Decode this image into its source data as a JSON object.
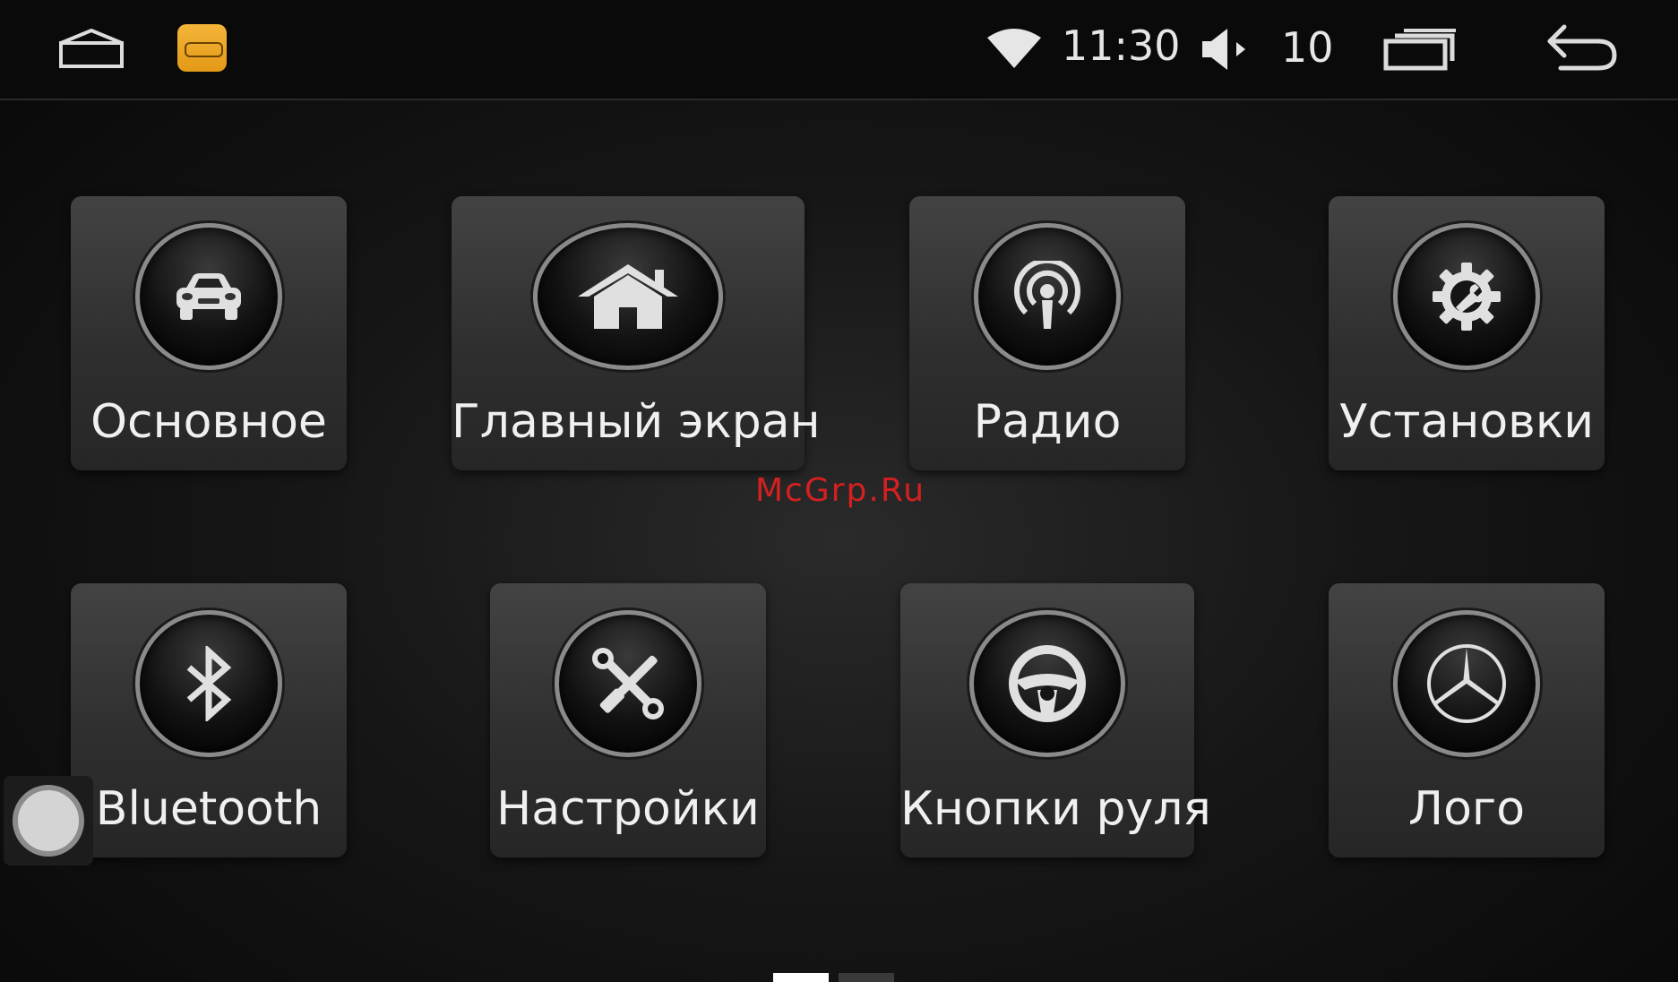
{
  "status_bar": {
    "time": "11:30",
    "volume_level": "10",
    "app_badge_color": "#f0a82a"
  },
  "tiles": [
    {
      "label": "Основное",
      "icon": "car-icon"
    },
    {
      "label": "Главный экран",
      "icon": "house-icon"
    },
    {
      "label": "Радио",
      "icon": "radio-broadcast-icon"
    },
    {
      "label": "Установки",
      "icon": "gear-wrench-icon"
    },
    {
      "label": "Bluetooth",
      "icon": "bluetooth-icon"
    },
    {
      "label": "Настройки",
      "icon": "wrench-screwdriver-icon"
    },
    {
      "label": "Кнопки руля",
      "icon": "steering-wheel-icon"
    },
    {
      "label": "Лого",
      "icon": "mercedes-star-icon"
    }
  ],
  "watermark": "McGrp.Ru",
  "pager": {
    "pages": 2,
    "current": 1
  },
  "colors": {
    "background": "#0b0b0b",
    "tile": "#333333",
    "text": "#f0f0f0",
    "watermark": "#d42020"
  }
}
